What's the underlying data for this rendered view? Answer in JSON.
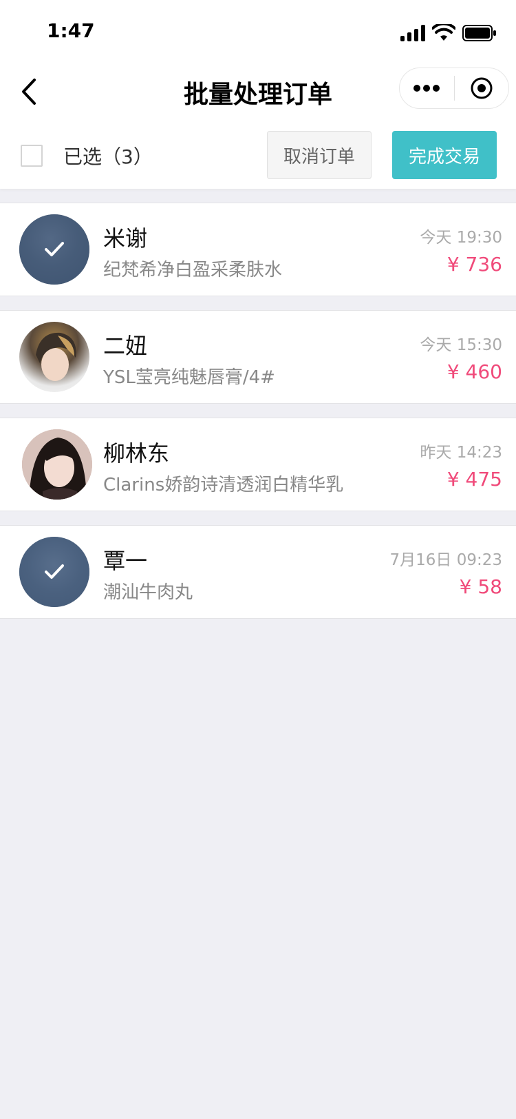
{
  "status_bar": {
    "time": "1:47"
  },
  "nav": {
    "title": "批量处理订单"
  },
  "action_bar": {
    "selected_label": "已选（3）",
    "cancel_label": "取消订单",
    "done_label": "完成交易"
  },
  "colors": {
    "accent": "#40c0c8",
    "price": "#f04a7a",
    "background": "#efeff4"
  },
  "orders": [
    {
      "name": "米谢",
      "product": " 纪梵希净白盈采柔肤水",
      "time": "今天 19:30",
      "price": "¥ 736",
      "selected": true
    },
    {
      "name": "二妞",
      "product": "YSL莹亮纯魅唇膏/4#",
      "time": "今天 15:30",
      "price": "¥ 460",
      "selected": false
    },
    {
      "name": "柳林东",
      "product": "Clarins娇韵诗清透润白精华乳",
      "time": "昨天 14:23",
      "price": "¥ 475",
      "selected": false
    },
    {
      "name": "覃一",
      "product": "潮汕牛肉丸",
      "time": "7月16日 09:23",
      "price": "¥ 58",
      "selected": true
    }
  ]
}
